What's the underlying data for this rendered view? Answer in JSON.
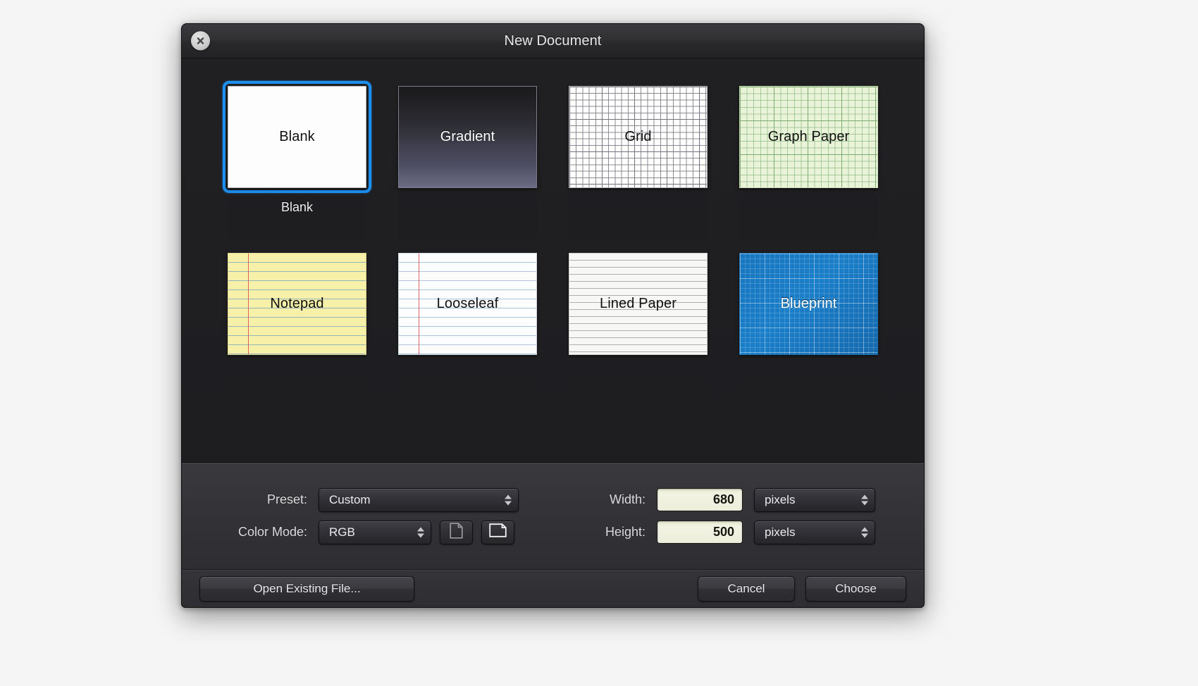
{
  "window": {
    "title": "New Document",
    "close_icon": "close-circle-x-icon"
  },
  "gallery": {
    "templates": [
      {
        "id": "blank",
        "label": "Blank",
        "surface": "blank",
        "selected": true,
        "label_below": "Blank"
      },
      {
        "id": "gradient",
        "label": "Gradient",
        "surface": "gradient",
        "selected": false,
        "label_below": ""
      },
      {
        "id": "grid",
        "label": "Grid",
        "surface": "grid",
        "selected": false,
        "label_below": ""
      },
      {
        "id": "graphpaper",
        "label": "Graph Paper",
        "surface": "graph",
        "selected": false,
        "label_below": ""
      },
      {
        "id": "notepad",
        "label": "Notepad",
        "surface": "notepad",
        "selected": false,
        "label_below": ""
      },
      {
        "id": "looseleaf",
        "label": "Looseleaf",
        "surface": "looseleaf",
        "selected": false,
        "label_below": ""
      },
      {
        "id": "linedpaper",
        "label": "Lined Paper",
        "surface": "lined",
        "selected": false,
        "label_below": ""
      },
      {
        "id": "blueprint",
        "label": "Blueprint",
        "surface": "blueprint",
        "selected": false,
        "label_below": ""
      }
    ]
  },
  "options": {
    "preset": {
      "label": "Preset:",
      "value": "Custom",
      "options": [
        "Custom"
      ]
    },
    "color_mode": {
      "label": "Color Mode:",
      "value": "RGB",
      "options": [
        "RGB"
      ]
    },
    "orientation": {
      "portrait_icon": "document-portrait-icon",
      "landscape_icon": "document-landscape-icon",
      "selected": "landscape"
    },
    "width": {
      "label": "Width:",
      "value": "680",
      "unit": "pixels",
      "unit_options": [
        "pixels"
      ]
    },
    "height": {
      "label": "Height:",
      "value": "500",
      "unit": "pixels",
      "unit_options": [
        "pixels"
      ]
    }
  },
  "footer": {
    "open_existing": "Open Existing File...",
    "cancel": "Cancel",
    "choose": "Choose"
  },
  "colors": {
    "selection_blue": "#1e90f0",
    "window_bg": "#232326",
    "field_bg": "#eceddb"
  }
}
